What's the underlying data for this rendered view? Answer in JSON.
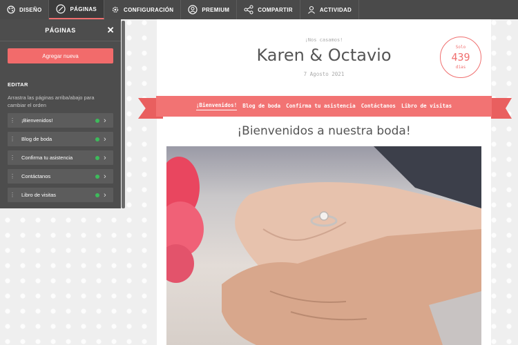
{
  "nav": {
    "items": [
      {
        "label": "DISEÑO",
        "icon": "palette-icon",
        "active": false
      },
      {
        "label": "PÁGINAS",
        "icon": "pages-icon",
        "active": true
      },
      {
        "label": "CONFIGURACIÓN",
        "icon": "gear-icon",
        "active": false
      },
      {
        "label": "PREMIUM",
        "icon": "premium-icon",
        "active": false
      },
      {
        "label": "COMPARTIR",
        "icon": "share-icon",
        "active": false
      },
      {
        "label": "ACTIVIDAD",
        "icon": "user-icon",
        "active": false
      }
    ]
  },
  "sidebar": {
    "title": "PÁGINAS",
    "add_button": "Agregar nueva",
    "edit_title": "EDITAR",
    "edit_help": "Arrastra las páginas arriba/abajo para cambiar el orden",
    "pages": [
      {
        "label": "¡Bienvenidos!",
        "status": "published"
      },
      {
        "label": "Blog de boda",
        "status": "published"
      },
      {
        "label": "Confirma tu asistencia",
        "status": "published"
      },
      {
        "label": "Contáctanos",
        "status": "published"
      },
      {
        "label": "Libro de visitas",
        "status": "published"
      }
    ]
  },
  "site": {
    "pretitle": "¡Nos casamos!",
    "couple": "Karen & Octavio",
    "date": "7 Agosto 2021",
    "countdown": {
      "top": "Solo",
      "number": "439",
      "bottom": "días"
    },
    "menu": [
      "¡Bienvenidos!",
      "Blog de boda",
      "Confirma tu asistencia",
      "Contáctanos",
      "Libro de visitas"
    ],
    "active_menu": 0,
    "welcome_heading": "¡Bienvenidos a nuestra boda!",
    "photo_subject": "hands-with-engagement-ring-photo"
  },
  "colors": {
    "accent": "#f27373",
    "nav_bg": "#4a4a4a",
    "sidebar_bg": "#4d4d4d",
    "status_green": "#3dbb5b"
  }
}
